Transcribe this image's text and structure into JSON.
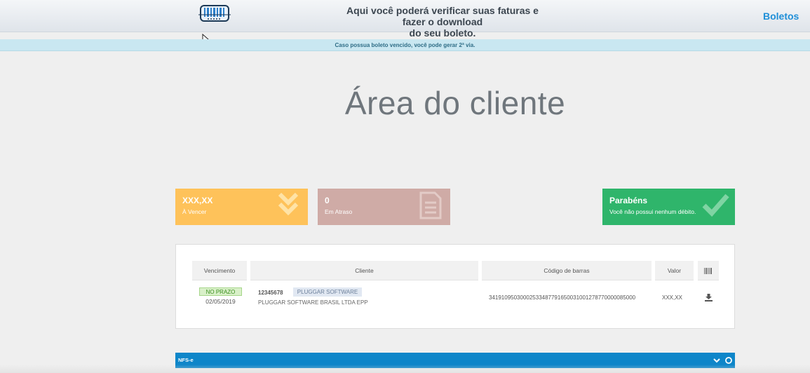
{
  "header": {
    "line1": "Aqui você poderá verificar suas faturas e fazer o download",
    "line2": "do seu boleto.",
    "nav_link": "Boletos"
  },
  "notice": "Caso possua boleto vencido, você pode gerar 2ª via.",
  "page_title": "Área do cliente",
  "cards": [
    {
      "value": "XXX,XX",
      "label": "À Vencer",
      "color": "#fec25a",
      "icon": "double-chevron-down-icon"
    },
    {
      "value": "0",
      "label": "Em Atraso",
      "color": "#cfaba6",
      "icon": "document-icon"
    },
    {
      "value": "Parabéns",
      "label": "Você não possui nenhum débito.",
      "color": "#2fb56b",
      "icon": "checkmark-icon"
    }
  ],
  "table": {
    "headers": {
      "vencimento": "Vencimento",
      "cliente": "Cliente",
      "codigo": "Código de barras",
      "valor": "Valor"
    },
    "rows": [
      {
        "status": "NO PRAZO",
        "due_date": "02/05/2019",
        "client_code": "12345678",
        "client_tag": "PLUGGAR SOFTWARE",
        "client_name": "PLUGGAR SOFTWARE BRASIL LTDA EPP",
        "barcode": "34191095030002533487791650031001278770000085000",
        "value": "XXX,XX"
      }
    ]
  },
  "nfse": {
    "label": "NFS-e"
  }
}
